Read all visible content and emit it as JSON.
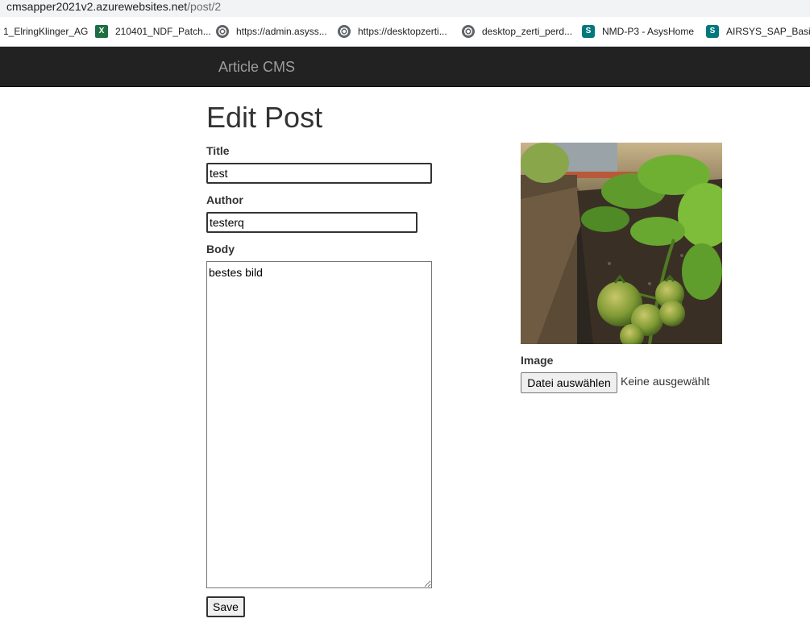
{
  "browser": {
    "url_host": "cmsapper2021v2.azurewebsites.net",
    "url_path": "/post/2"
  },
  "bookmarks": [
    {
      "label": "1_ElringKlinger_AG",
      "icon": "none"
    },
    {
      "label": "210401_NDF_Patch...",
      "icon": "excel-icon"
    },
    {
      "label": "https://admin.asyss...",
      "icon": "globe-icon"
    },
    {
      "label": "https://desktopzerti...",
      "icon": "globe-icon"
    },
    {
      "label": "desktop_zerti_perd...",
      "icon": "globe-icon"
    },
    {
      "label": "NMD-P3 - AsysHome",
      "icon": "sharepoint-icon"
    },
    {
      "label": "AIRSYS_SAP_Basis_",
      "icon": "sharepoint-icon"
    }
  ],
  "navbar": {
    "brand": "Article CMS",
    "bg_color": "#222222",
    "brand_color": "#9d9d9d"
  },
  "form": {
    "heading": "Edit Post",
    "title_label": "Title",
    "title_value": "test",
    "author_label": "Author",
    "author_value": "testerq",
    "body_label": "Body",
    "body_value": "bestes bild",
    "save_label": "Save"
  },
  "image_panel": {
    "image_label": "Image",
    "file_button_label": "Datei auswählen",
    "file_status": "Keine ausgewählt",
    "photo_subject": "tomato plants in raised garden bed"
  }
}
